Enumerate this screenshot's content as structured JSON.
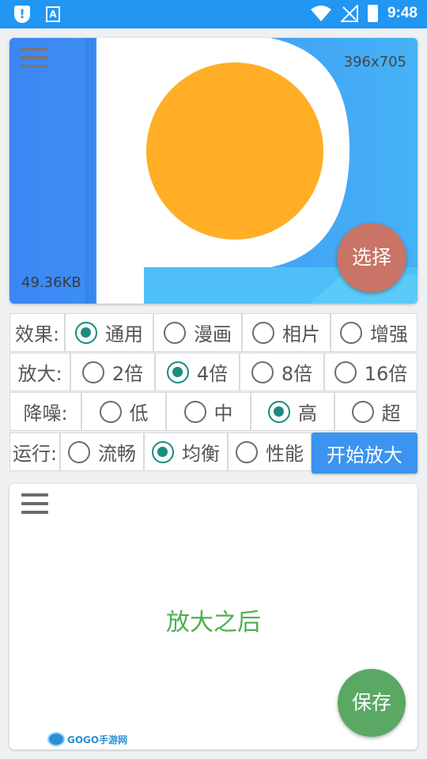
{
  "status_bar": {
    "time": "9:48",
    "left_icons": [
      "shield-alert-icon",
      "a-keyboard-icon"
    ],
    "right_icons": [
      "wifi-icon",
      "no-signal-icon",
      "battery-charging-icon"
    ]
  },
  "preview": {
    "dimensions": "396x705",
    "file_size": "49.36KB",
    "select_label": "选择",
    "menu_icon": "menu-icon"
  },
  "options": {
    "effect": {
      "label": "效果:",
      "choices": [
        "通用",
        "漫画",
        "相片",
        "增强"
      ],
      "selected": "通用"
    },
    "scale": {
      "label": "放大:",
      "choices": [
        "2倍",
        "4倍",
        "8倍",
        "16倍"
      ],
      "selected": "4倍"
    },
    "denoise": {
      "label": "降噪:",
      "choices": [
        "低",
        "中",
        "高",
        "超"
      ],
      "selected": "高"
    },
    "run": {
      "label": "运行:",
      "choices": [
        "流畅",
        "均衡",
        "性能"
      ],
      "selected": "均衡"
    },
    "start_label": "开始放大"
  },
  "result": {
    "placeholder": "放大之后",
    "save_label": "保存",
    "watermark": "GOGO手游网"
  },
  "colors": {
    "status_bar": "#2196f3",
    "accent_blue": "#3b94f0",
    "radio_selected": "#1a8c7e",
    "select_button": "#c97466",
    "save_button": "#5aa864",
    "result_text": "#4caf50"
  }
}
